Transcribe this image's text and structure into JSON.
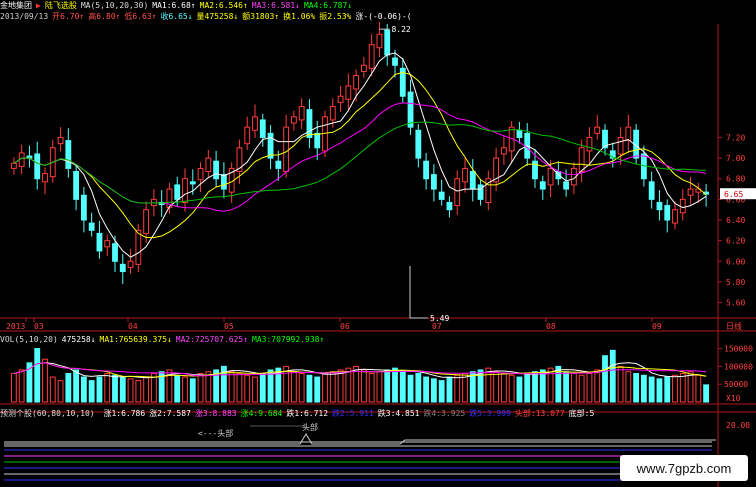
{
  "header": {
    "stock_name": "金地集团",
    "marker": "▶",
    "indicator_name": "陆飞选股",
    "ma_label": "MA(5,10,20,30)",
    "ma1": "MA1:6.68↑",
    "ma2": "MA2:6.546↑",
    "ma3": "MA3:6.581↓",
    "ma4": "MA4:6.787↓"
  },
  "quote": {
    "date": "2013/09/13",
    "open": "开6.70↑",
    "high": "高6.80↑",
    "low": "低6.63↑",
    "close": "收6.65↓",
    "volume": "量475258↓",
    "amount": "额31803↑",
    "turnover": "换1.06%",
    "amplitude": "振2.53%",
    "change": "涨-(-0.06)-("
  },
  "price_panel": {
    "high_label": "8.22",
    "low_label": "5.49",
    "current_tag": "6.65",
    "y_ticks": [
      "7.20",
      "7.00",
      "6.80",
      "6.60",
      "6.40",
      "6.20",
      "6.00",
      "5.80",
      "5.60"
    ],
    "y_min": 5.45,
    "y_max": 8.3
  },
  "time_axis": {
    "labels": [
      "2013",
      "03",
      "04",
      "05",
      "06",
      "07",
      "08",
      "09"
    ],
    "period": "日线"
  },
  "vol_header": {
    "label": "VOL(5,10,20)",
    "value": "475258↓",
    "ma1": "MA1:765639.375↓",
    "ma2": "MA2:725707.625↑",
    "ma3": "MA3:707992.938↑"
  },
  "vol_axis": {
    "ticks": [
      "150000",
      "100000",
      "50000"
    ],
    "unit": "X10"
  },
  "indicator_header": {
    "name": "预测个股(60,80,10,10)",
    "items": [
      {
        "text": "涨1:6.786",
        "color": "#ffffff"
      },
      {
        "text": "涨2:7.587",
        "color": "#ffffff"
      },
      {
        "text": "涨3:8.883",
        "color": "#ff44ff"
      },
      {
        "text": "涨4:9.684",
        "color": "#00ff00"
      },
      {
        "text": "跌1:6.712",
        "color": "#ffffff"
      },
      {
        "text": "跌2:5.911",
        "color": "#3030ff"
      },
      {
        "text": "跌3:4.851",
        "color": "#ffffff"
      },
      {
        "text": "跌4:3.925",
        "color": "#808080"
      },
      {
        "text": "跌5:3.999",
        "color": "#3030ff"
      },
      {
        "text": "头部:13.077",
        "color": "#ff4040"
      },
      {
        "text": "底部:5",
        "color": "#ffffff"
      }
    ]
  },
  "indicator_panel": {
    "top_tick": "20.00",
    "annotation_left": "<---头部",
    "annotation_peak": "头部"
  },
  "watermark": "www.7gpzb.com",
  "colors": {
    "up": "#ff3c3c",
    "down": "#54ffff",
    "ma_white": "#ffffff",
    "ma_yellow": "#ffff00",
    "ma_magenta": "#ff00ff",
    "ma_green": "#00c000"
  },
  "chart_data": {
    "type": "line",
    "price_series": [
      6.95,
      7.05,
      7.0,
      6.8,
      6.85,
      7.1,
      7.2,
      6.9,
      6.6,
      6.4,
      6.3,
      6.1,
      6.2,
      6.0,
      5.9,
      6.0,
      6.3,
      6.5,
      6.6,
      6.55,
      6.7,
      6.6,
      6.8,
      6.75,
      6.9,
      7.0,
      6.8,
      6.7,
      6.9,
      7.1,
      7.3,
      7.4,
      7.2,
      7.0,
      6.9,
      7.3,
      7.4,
      7.5,
      7.2,
      7.1,
      7.4,
      7.5,
      7.6,
      7.7,
      7.8,
      7.9,
      8.1,
      8.2,
      8.0,
      7.9,
      7.6,
      7.3,
      7.0,
      6.8,
      6.7,
      6.6,
      6.5,
      6.8,
      6.9,
      6.7,
      6.6,
      6.8,
      7.0,
      7.1,
      7.3,
      7.2,
      7.0,
      6.8,
      6.7,
      6.9,
      6.8,
      6.7,
      6.9,
      7.1,
      7.2,
      7.3,
      7.1,
      7.0,
      7.2,
      7.3,
      7.0,
      6.8,
      6.6,
      6.5,
      6.4,
      6.5,
      6.6,
      6.7,
      6.7,
      6.65
    ],
    "volume_series": [
      80,
      90,
      110,
      150,
      120,
      70,
      60,
      80,
      90,
      70,
      60,
      70,
      80,
      75,
      70,
      65,
      60,
      70,
      80,
      85,
      90,
      75,
      70,
      65,
      80,
      85,
      90,
      100,
      85,
      80,
      75,
      70,
      80,
      90,
      95,
      100,
      85,
      80,
      75,
      70,
      80,
      85,
      90,
      95,
      100,
      90,
      80,
      85,
      90,
      95,
      85,
      75,
      80,
      70,
      65,
      60,
      70,
      75,
      80,
      85,
      90,
      95,
      85,
      80,
      75,
      70,
      80,
      85,
      90,
      95,
      100,
      85,
      80,
      75,
      80,
      90,
      130,
      145,
      100,
      85,
      80,
      75,
      70,
      65,
      70,
      75,
      80,
      85,
      75,
      48
    ],
    "vol_ylim": [
      0,
      160000
    ]
  }
}
